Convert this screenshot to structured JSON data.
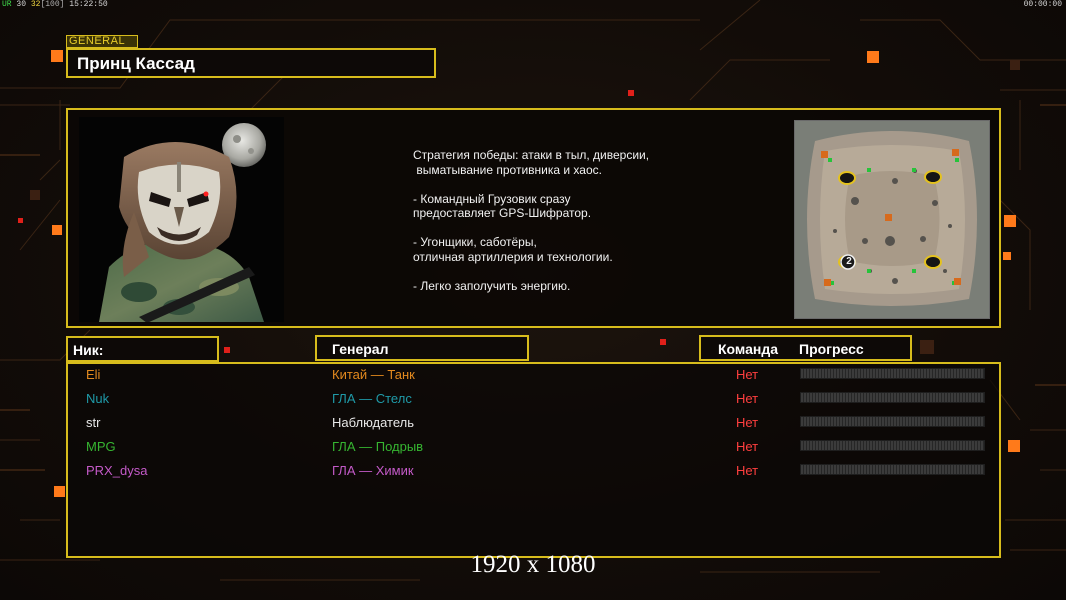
{
  "hud": {
    "left_a": "UR",
    "left_b": "30",
    "left_c": "32",
    "left_d": "[100]",
    "clock": "15:22:50",
    "right": "00:00:00"
  },
  "general": {
    "tag": "GENERAL",
    "name": "Принц Кассад"
  },
  "description": {
    "lines": [
      "Стратегия победы: атаки в тыл, диверсии,",
      " выматывание противника и хаос.",
      "",
      "- Командный Грузовик сразу",
      "предоставляет GPS-Шифратор.",
      "",
      "- Угонщики, саботёры,",
      "отличная артиллерия и технологии.",
      "",
      "- Легко заполучить энергию."
    ]
  },
  "map": {
    "badge": "2"
  },
  "columns": {
    "nick": "Ник:",
    "general": "Генерал",
    "team": "Команда",
    "progress": "Прогресс"
  },
  "players": [
    {
      "nick": "Eli",
      "general": "Китай — Танк",
      "team": "Нет",
      "color": "#e2891e",
      "progress": 0
    },
    {
      "nick": "Nuk",
      "general": "ГЛА — Стелс",
      "team": "Нет",
      "color": "#1f9aa8",
      "progress": 0
    },
    {
      "nick": "str",
      "general": "Наблюдатель",
      "team": "Нет",
      "color": "#e8e8e8",
      "progress": 0
    },
    {
      "nick": "MPG",
      "general": "ГЛА — Подрыв",
      "team": "Нет",
      "color": "#36b531",
      "progress": 0
    },
    {
      "nick": "PRX_dysa",
      "general": "ГЛА — Химик",
      "team": "Нет",
      "color": "#c45ac8",
      "progress": 0
    }
  ],
  "overlay": {
    "resolution": "1920 x 1080"
  },
  "colors": {
    "frame": "#d7bc1c",
    "accent": "#ff7a1a",
    "team_none": "#ff3f3f"
  }
}
